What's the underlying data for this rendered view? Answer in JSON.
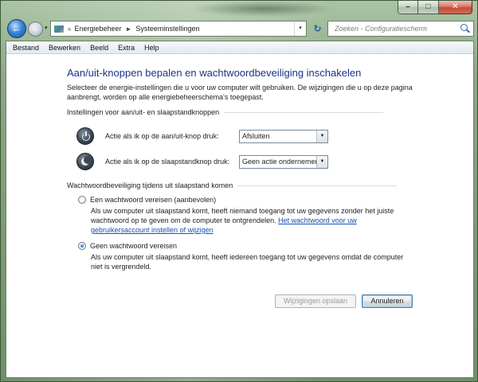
{
  "window": {
    "caption_buttons": {
      "minimize": "–",
      "maximize": "□",
      "close": "✕"
    }
  },
  "nav": {
    "back_glyph": "←",
    "forward_glyph": "→",
    "history_glyph": "▾",
    "breadcrumb": {
      "root_chevron": "«",
      "items": [
        "Energiebeheer",
        "Systeeminstellingen"
      ],
      "separator": "►"
    },
    "address_dropdown_glyph": "▾",
    "refresh_glyph": "↻",
    "search_placeholder": "Zoeken - Configuratiescherm"
  },
  "menu": {
    "items": [
      "Bestand",
      "Bewerken",
      "Beeld",
      "Extra",
      "Help"
    ]
  },
  "page": {
    "title": "Aan/uit-knoppen bepalen en wachtwoordbeveiliging inschakelen",
    "intro": "Selecteer de energie-instellingen die u voor uw computer wilt gebruiken. De wijzigingen die u op deze pagina aanbrengt, worden op alle energiebeheerschema's toegepast.",
    "buttons_section": {
      "heading": "Instellingen voor aan/uit- en slaapstandknoppen",
      "power_button": {
        "label": "Actie als ik op de aan/uit-knop druk:",
        "value": "Afsluiten",
        "icon": "power-icon"
      },
      "sleep_button": {
        "label": "Actie als ik op de slaapstandknop druk:",
        "value": "Geen actie ondernemen",
        "icon": "moon-icon"
      }
    },
    "password_section": {
      "heading": "Wachtwoordbeveiliging tijdens uit slaapstand komen",
      "option_require": {
        "label": "Een wachtwoord vereisen (aanbevolen)",
        "description": "Als uw computer uit slaapstand komt, heeft niemand toegang tot uw gegevens zonder het juiste wachtwoord op te geven om de computer te ontgrendelen.",
        "link": "Het wachtwoord voor uw gebruikersaccount instellen of wijzigen",
        "checked": false
      },
      "option_none": {
        "label": "Geen wachtwoord vereisen",
        "description": "Als uw computer uit slaapstand komt, heeft iedereen toegang tot uw gegevens omdat de computer niet is vergrendeld.",
        "checked": true
      }
    },
    "actions": {
      "save_label": "Wijzigingen opslaan",
      "cancel_label": "Annuleren"
    }
  },
  "colors": {
    "title": "#1e3287",
    "link": "#1a4fb5",
    "frame": "#7d9c77"
  }
}
